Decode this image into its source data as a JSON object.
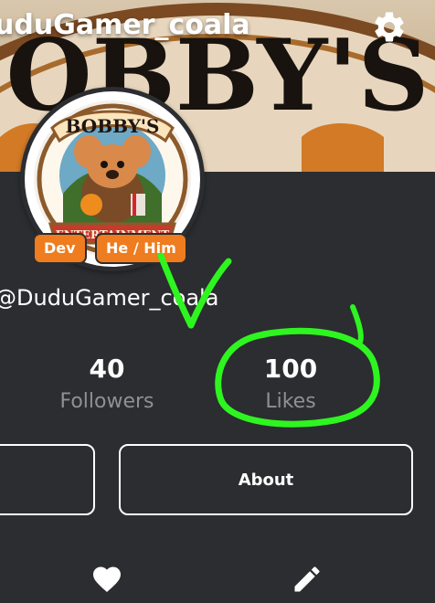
{
  "banner": {
    "title": "uduGamer_coala",
    "logo_text": "OBBY'S"
  },
  "icons": {
    "settings": "gear-icon",
    "like": "heart-icon",
    "edit": "pencil-icon"
  },
  "profile": {
    "avatar_text_top": "BOBBY'S",
    "avatar_text_bottom": "ENTERTAINMENT",
    "badges": [
      "Dev",
      "He / Him"
    ],
    "handle": "@DuduGamer_coala"
  },
  "stats": {
    "followers": {
      "value": "40",
      "label": "Followers"
    },
    "likes": {
      "value": "100",
      "label": "Likes"
    }
  },
  "actions": {
    "about_label": "About"
  },
  "colors": {
    "background": "#2b2d30",
    "badge": "#ef7c1e",
    "annotation": "#2ef51f",
    "muted_text": "#8d9096"
  }
}
